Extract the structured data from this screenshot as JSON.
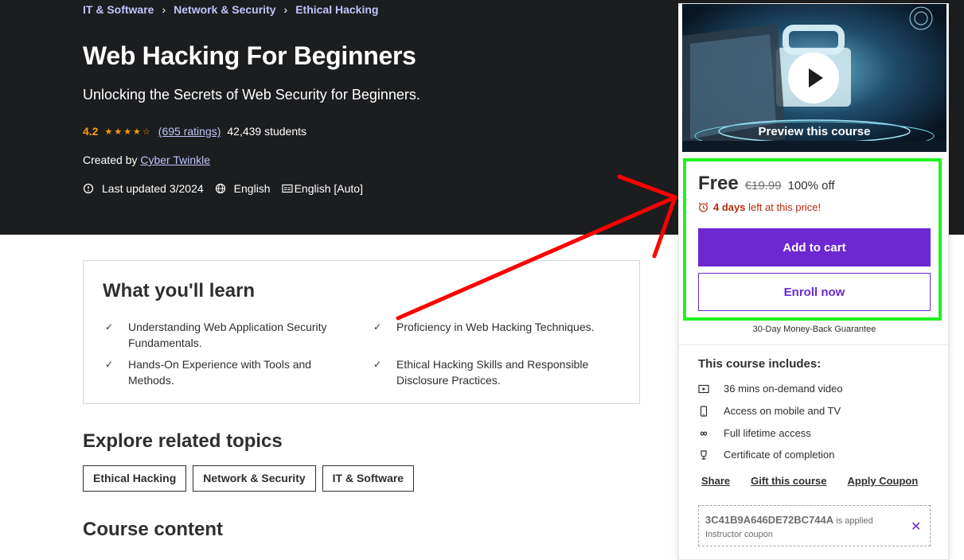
{
  "breadcrumb": [
    {
      "label": "IT & Software"
    },
    {
      "label": "Network & Security"
    },
    {
      "label": "Ethical Hacking"
    }
  ],
  "course": {
    "title": "Web Hacking For Beginners",
    "subtitle": "Unlocking the Secrets of Web Security for Beginners.",
    "rating": "4.2",
    "rating_value": 4.2,
    "ratings_count": "(695 ratings)",
    "students": "42,439 students",
    "created_by_label": "Created by",
    "author": "Cyber Twinkle",
    "last_updated": "Last updated 3/2024",
    "language": "English",
    "captions": "English [Auto]"
  },
  "learn": {
    "title": "What you'll learn",
    "items": [
      "Understanding Web Application Security Fundamentals.",
      "Proficiency in Web Hacking Techniques.",
      "Hands-On Experience with Tools and Methods.",
      "Ethical Hacking Skills and Responsible Disclosure Practices."
    ]
  },
  "related": {
    "title": "Explore related topics",
    "topics": [
      "Ethical Hacking",
      "Network & Security",
      "IT & Software"
    ]
  },
  "content": {
    "title": "Course content"
  },
  "sidebar": {
    "preview_label": "Preview this course",
    "price": "Free",
    "old_price": "€19.99",
    "discount": "100% off",
    "timer_bold": "4 days",
    "timer_rest": " left at this price!",
    "add_to_cart": "Add to cart",
    "enroll_now": "Enroll now",
    "guarantee": "30-Day Money-Back Guarantee",
    "includes_title": "This course includes:",
    "includes": [
      {
        "icon": "video-icon",
        "label": "36 mins on-demand video"
      },
      {
        "icon": "mobile-icon",
        "label": "Access on mobile and TV"
      },
      {
        "icon": "infinity-icon",
        "label": "Full lifetime access"
      },
      {
        "icon": "trophy-icon",
        "label": "Certificate of completion"
      }
    ],
    "share": "Share",
    "gift": "Gift this course",
    "apply_coupon": "Apply Coupon",
    "coupon_code": "3C41B9A646DE72BC744A",
    "coupon_applied": "is applied",
    "coupon_type": "Instructor coupon"
  },
  "colors": {
    "hero_bg": "#1c1d1f",
    "accent_purple": "#6d28d2",
    "star_orange": "#f69c08",
    "timer_red": "#b32d0f",
    "highlight_green": "#1ff21f",
    "annotation_red": "#ff0000"
  }
}
